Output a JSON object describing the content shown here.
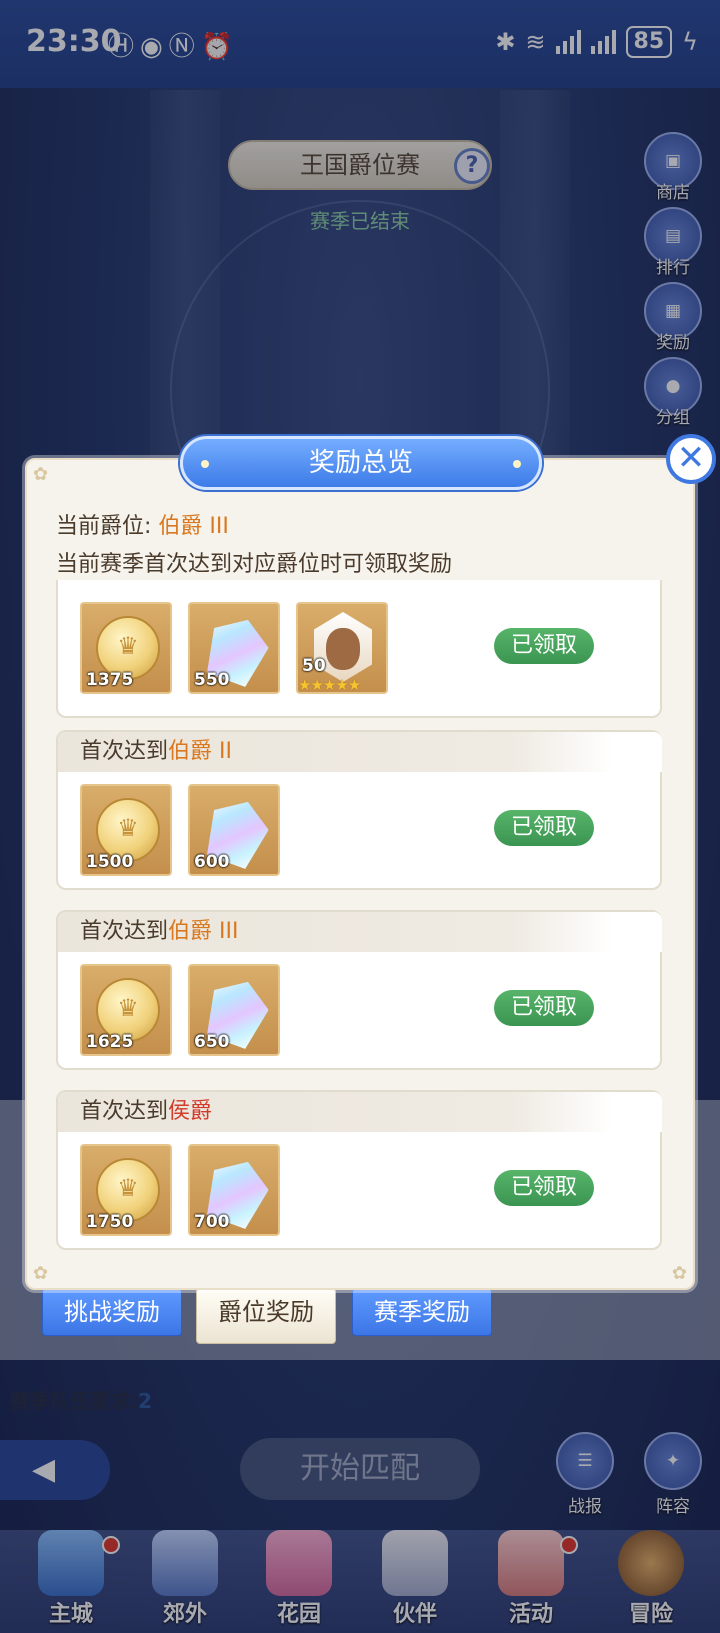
{
  "status_bar": {
    "time": "23:30",
    "left_icons": [
      "hd-icon",
      "eye-icon",
      "nfc-icon",
      "alarm-icon"
    ],
    "battery": "85"
  },
  "header": {
    "title": "王国爵位赛",
    "help": "?",
    "season_status": "赛季已结束"
  },
  "side_buttons": [
    {
      "label": "商店",
      "icon": "shop-icon"
    },
    {
      "label": "排行",
      "icon": "ranking-icon"
    },
    {
      "label": "奖励",
      "icon": "gift-icon"
    },
    {
      "label": "分组",
      "icon": "group-icon"
    }
  ],
  "modal": {
    "title": "奖励总览",
    "current_rank_label": "当前爵位:",
    "current_rank_value": "伯爵 III",
    "hint": "当前赛季首次达到对应爵位时可领取奖励",
    "close": "✕",
    "cards": [
      {
        "prefix": "",
        "rank": "",
        "items": [
          {
            "type": "coin",
            "count": "1375"
          },
          {
            "type": "gem",
            "count": "550"
          },
          {
            "type": "portrait",
            "count": "50",
            "stars": "★★★★★"
          }
        ],
        "status": "已领取"
      },
      {
        "prefix": "首次达到",
        "rank": "伯爵 II",
        "items": [
          {
            "type": "coin",
            "count": "1500"
          },
          {
            "type": "gem",
            "count": "600"
          }
        ],
        "status": "已领取"
      },
      {
        "prefix": "首次达到",
        "rank": "伯爵 III",
        "items": [
          {
            "type": "coin",
            "count": "1625"
          },
          {
            "type": "gem",
            "count": "650"
          }
        ],
        "status": "已领取"
      },
      {
        "prefix": "首次达到",
        "rank": "侯爵",
        "items": [
          {
            "type": "coin",
            "count": "1750"
          },
          {
            "type": "gem",
            "count": "700"
          }
        ],
        "status": "已领取"
      }
    ]
  },
  "reward_tabs": [
    {
      "label": "挑战奖励"
    },
    {
      "label": "爵位奖励"
    },
    {
      "label": "赛季奖励"
    }
  ],
  "team_requirement": {
    "label": "赛季队伍要求:",
    "value": "2"
  },
  "start_match": "开始匹配",
  "bottom_actions": [
    {
      "label": "战报",
      "icon": "report-icon"
    },
    {
      "label": "阵容",
      "icon": "lineup-icon"
    }
  ],
  "nav": [
    {
      "label": "主城",
      "icon": "castle-icon"
    },
    {
      "label": "郊外",
      "icon": "suburb-icon"
    },
    {
      "label": "花园",
      "icon": "garden-icon"
    },
    {
      "label": "伙伴",
      "icon": "partner-icon"
    },
    {
      "label": "活动",
      "icon": "event-gift-icon"
    },
    {
      "label": "冒险",
      "icon": "adventure-icon"
    }
  ],
  "colors": {
    "accent_blue": "#3c76e6",
    "claimed_green": "#3b9552",
    "rank_orange": "#d9781e",
    "rank_red": "#d23a2a"
  }
}
